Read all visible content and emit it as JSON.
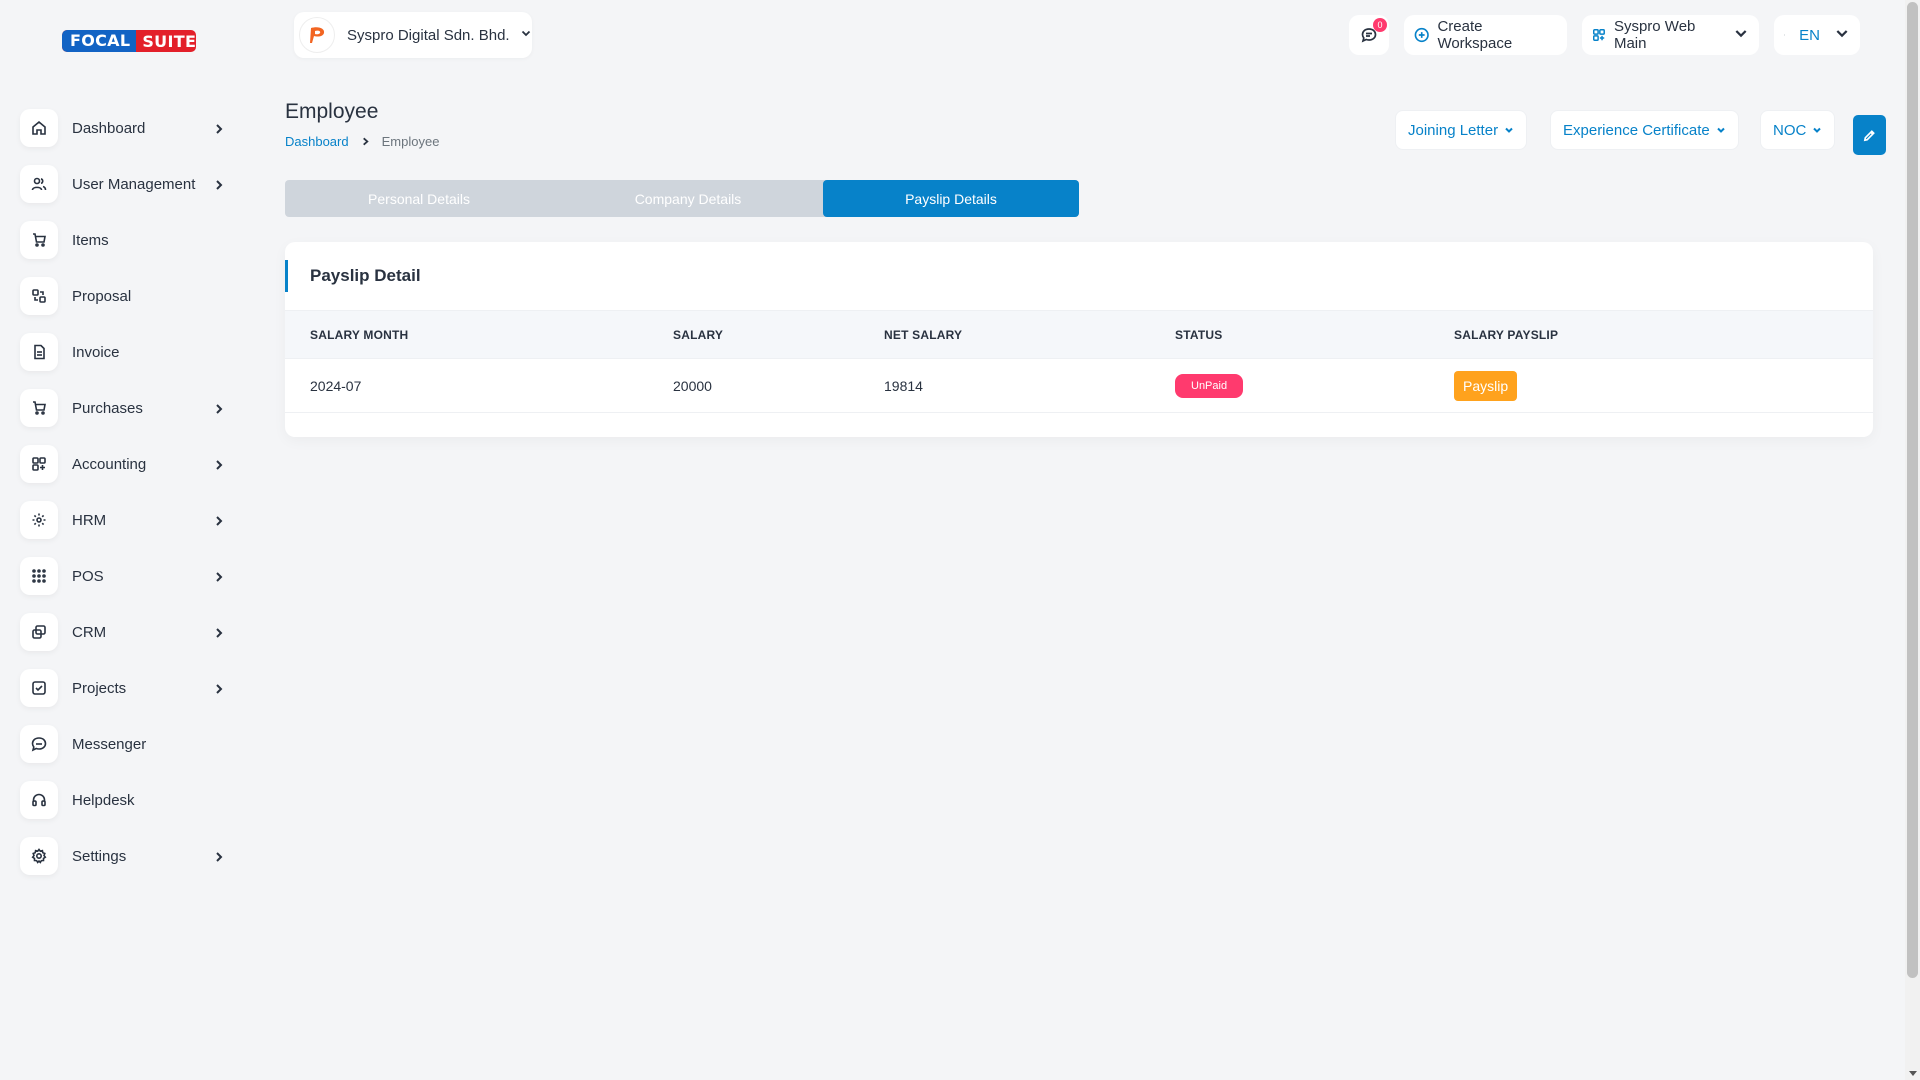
{
  "brand": {
    "part1": "FOCAL",
    "part2": "SUITE"
  },
  "sidebar": {
    "items": [
      {
        "label": "Dashboard",
        "icon": "home-icon",
        "has_children": true
      },
      {
        "label": "User Management",
        "icon": "users-icon",
        "has_children": true
      },
      {
        "label": "Items",
        "icon": "cart-icon",
        "has_children": false
      },
      {
        "label": "Proposal",
        "icon": "proposal-icon",
        "has_children": false
      },
      {
        "label": "Invoice",
        "icon": "invoice-icon",
        "has_children": false
      },
      {
        "label": "Purchases",
        "icon": "cart-icon",
        "has_children": true
      },
      {
        "label": "Accounting",
        "icon": "apps-icon",
        "has_children": true
      },
      {
        "label": "HRM",
        "icon": "hrm-icon",
        "has_children": true
      },
      {
        "label": "POS",
        "icon": "grid-icon",
        "has_children": true
      },
      {
        "label": "CRM",
        "icon": "crm-icon",
        "has_children": true
      },
      {
        "label": "Projects",
        "icon": "check-square-icon",
        "has_children": true
      },
      {
        "label": "Messenger",
        "icon": "message-icon",
        "has_children": false
      },
      {
        "label": "Helpdesk",
        "icon": "headset-icon",
        "has_children": false
      },
      {
        "label": "Settings",
        "icon": "gear-icon",
        "has_children": true
      }
    ]
  },
  "header": {
    "company": "Syspro Digital Sdn. Bhd.",
    "notification_count": "0",
    "create_workspace": "Create Workspace",
    "workspace": "Syspro Web Main",
    "language": "EN"
  },
  "page": {
    "title": "Employee",
    "breadcrumb": {
      "home": "Dashboard",
      "current": "Employee"
    },
    "actions": {
      "joining_letter": "Joining Letter",
      "experience_certificate": "Experience Certificate",
      "noc": "NOC"
    }
  },
  "tabs": [
    {
      "label": "Personal Details",
      "active": false
    },
    {
      "label": "Company Details",
      "active": false
    },
    {
      "label": "Payslip Details",
      "active": true
    }
  ],
  "payslip": {
    "title": "Payslip Detail",
    "columns": [
      "SALARY MONTH",
      "SALARY",
      "NET SALARY",
      "STATUS",
      "SALARY PAYSLIP"
    ],
    "rows": [
      {
        "month": "2024-07",
        "salary": "20000",
        "net_salary": "19814",
        "status": "UnPaid",
        "action": "Payslip"
      }
    ]
  },
  "colors": {
    "primary": "#0782c9",
    "danger": "#ff3a6e",
    "warning": "#ffa21d"
  }
}
